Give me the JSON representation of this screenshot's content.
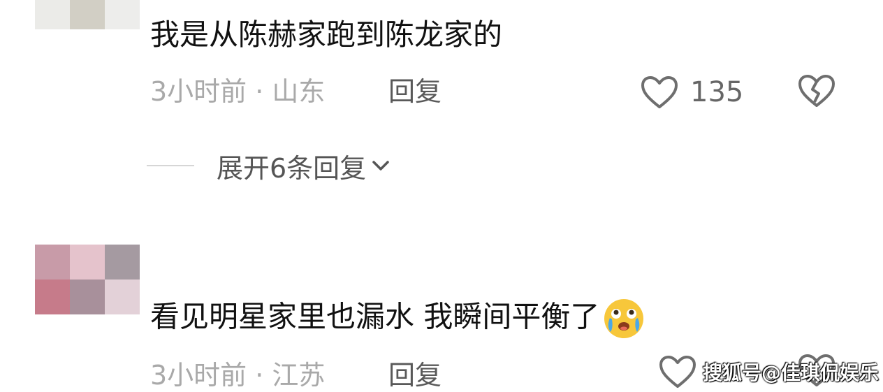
{
  "comments": [
    {
      "text": "我是从陈赫家跑到陈龙家的",
      "meta": "3小时前 · 山东",
      "reply_label": "回复",
      "like_count": "135",
      "expand_label": "展开6条回复"
    },
    {
      "text": "看见明星家里也漏水 我瞬间平衡了",
      "meta": "3小时前 · 江苏",
      "reply_label": "回复",
      "like_count": ""
    }
  ],
  "watermark": "搜狐号@佳琪侃娱乐",
  "icons": {
    "like": "heart-outline-icon",
    "dislike": "broken-heart-icon",
    "expand": "chevron-down-icon",
    "emoji": "crying-laughing-emoji"
  },
  "colors": {
    "text_primary": "#111111",
    "text_meta": "#a9a9a9",
    "text_reply": "#595959",
    "icon_gray": "#6e6e6e",
    "emoji_yellow": "#f7c73b"
  }
}
